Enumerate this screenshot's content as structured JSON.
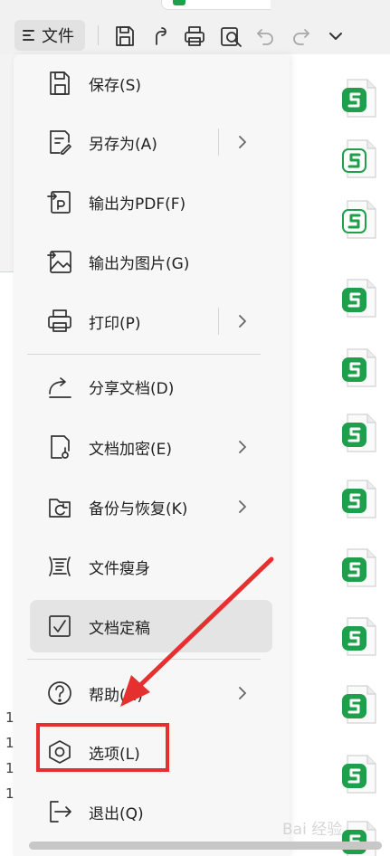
{
  "toolbar": {
    "file_menu_label": "文件",
    "icons": [
      "save-icon",
      "share-icon",
      "print-icon",
      "print-preview-icon",
      "undo-icon",
      "redo-icon",
      "chevron-down-icon"
    ]
  },
  "file_menu": {
    "items": [
      {
        "label": "保存(S)",
        "icon": "save-icon",
        "has_submenu": false
      },
      {
        "label": "另存为(A)",
        "icon": "save-as-icon",
        "has_submenu": true
      },
      {
        "label": "输出为PDF(F)",
        "icon": "export-pdf-icon",
        "has_submenu": false
      },
      {
        "label": "输出为图片(G)",
        "icon": "export-image-icon",
        "has_submenu": false
      },
      {
        "label": "打印(P)",
        "icon": "print-icon",
        "has_submenu": true
      },
      {
        "label": "分享文档(D)",
        "icon": "share-icon",
        "has_submenu": false
      },
      {
        "label": "文档加密(E)",
        "icon": "encrypt-icon",
        "has_submenu": true
      },
      {
        "label": "备份与恢复(K)",
        "icon": "backup-icon",
        "has_submenu": true
      },
      {
        "label": "文件瘦身",
        "icon": "slim-icon",
        "has_submenu": false
      },
      {
        "label": "文档定稿",
        "icon": "finalize-icon",
        "has_submenu": false
      },
      {
        "label": "帮助(H)",
        "icon": "help-icon",
        "has_submenu": true
      },
      {
        "label": "选项(L)",
        "icon": "options-icon",
        "has_submenu": false
      },
      {
        "label": "退出(Q)",
        "icon": "exit-icon",
        "has_submenu": false
      }
    ]
  },
  "sheet": {
    "row_digits": [
      "1",
      "1",
      "1",
      "1"
    ]
  },
  "annotation": {
    "highlight_color": "#e5302f"
  },
  "watermark": "Bai 经验",
  "colors": {
    "spreadsheet_green": "#1e9f4b",
    "menu_bg": "#f7f7f7",
    "active_item_bg": "#e4e4e4"
  }
}
